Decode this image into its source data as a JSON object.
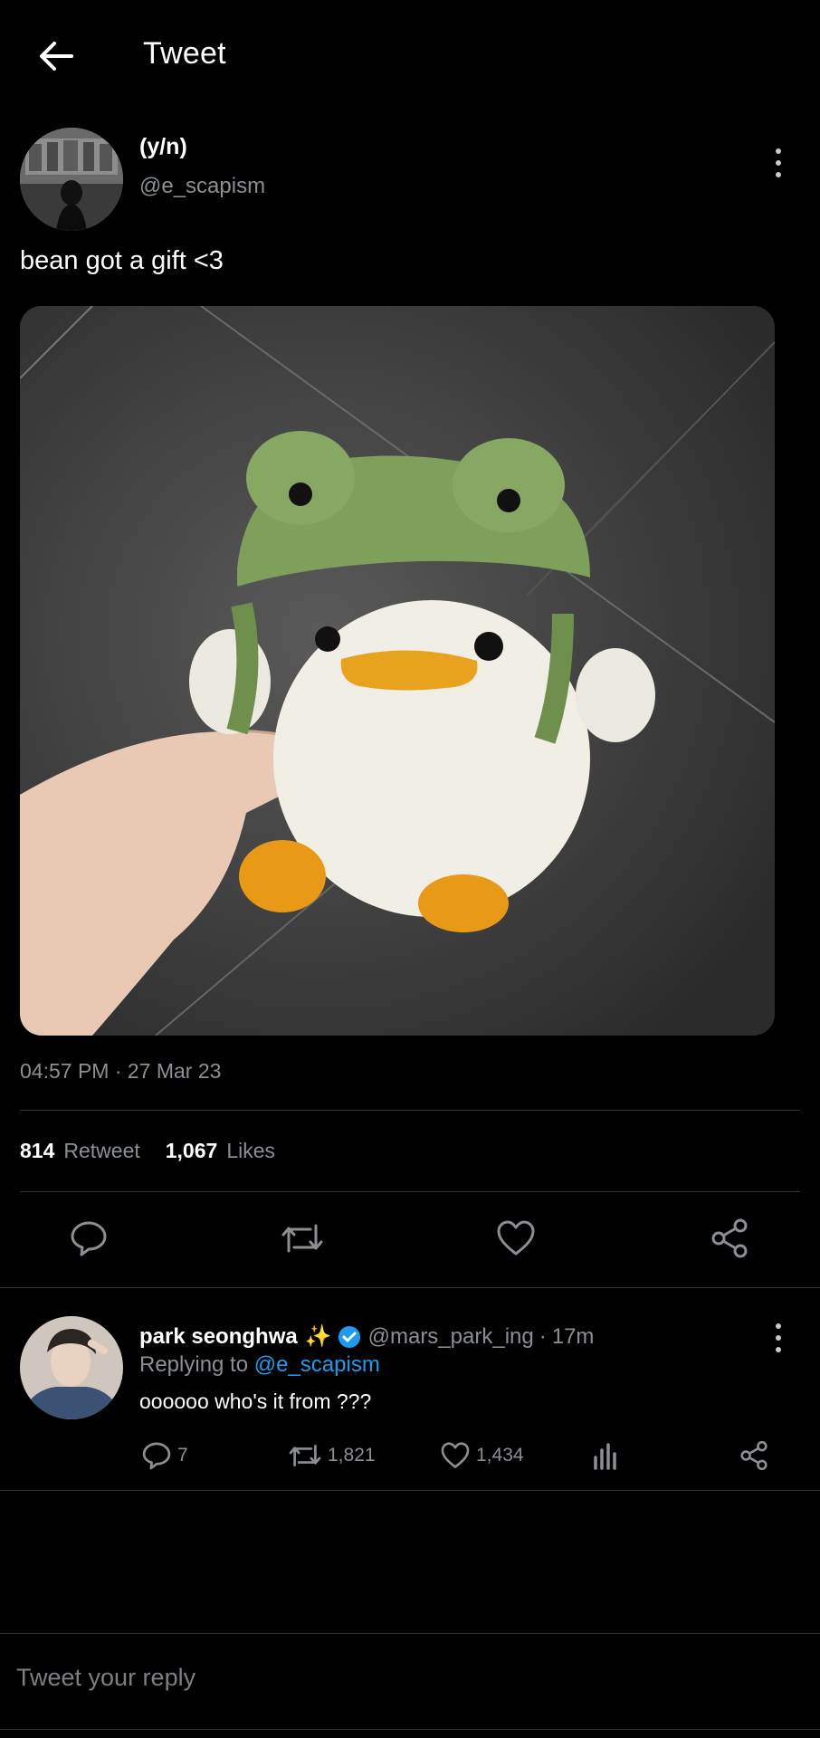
{
  "header": {
    "title": "Tweet",
    "back_icon": "arrow-left-icon"
  },
  "tweet": {
    "author_name": "(y/n)",
    "author_handle": "@e_scapism",
    "text": "bean got a gift <3",
    "media_alt_icon": "photo-crochet-duck-frog-hat",
    "timestamp": "04:57 PM · 27 Mar 23",
    "stats": {
      "retweets_count": "814",
      "retweets_label": "Retweet",
      "likes_count": "1,067",
      "likes_label": "Likes"
    },
    "actions": [
      "reply-icon",
      "retweet-icon",
      "heart-icon",
      "share-icon"
    ]
  },
  "reply": {
    "name": "park seonghwa",
    "sparkle": "✨",
    "verified_icon": "verified-badge-icon",
    "handle": "@mars_park_ing",
    "separator": "·",
    "time": "17m",
    "replying_label": "Replying to",
    "replying_handle": "@e_scapism",
    "text": "oooooo who's it from ???",
    "counts": {
      "replies": "7",
      "retweets": "1,821",
      "likes": "1,434"
    }
  },
  "compose": {
    "placeholder": "Tweet your reply"
  },
  "colors": {
    "background": "#000000",
    "text": "#ffffff",
    "muted": "#8b8f94",
    "accent": "#1d9bf0",
    "divider": "#2f3336"
  }
}
